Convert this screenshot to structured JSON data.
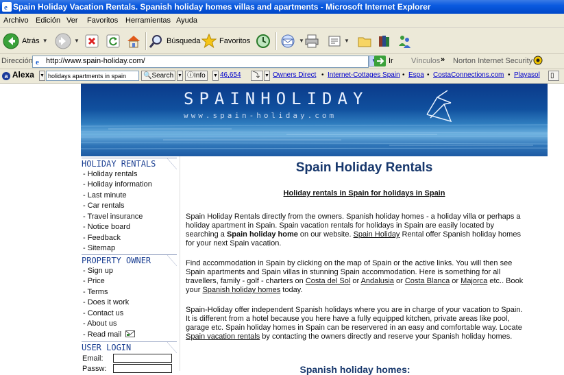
{
  "window": {
    "title": "Spain Holiday Vacation Rentals. Spanish holiday homes villas and apartments - Microsoft Internet Explorer"
  },
  "menu": [
    "Archivo",
    "Edición",
    "Ver",
    "Favoritos",
    "Herramientas",
    "Ayuda"
  ],
  "toolbar": {
    "back": "Atrás",
    "search": "Búsqueda",
    "favorites": "Favoritos"
  },
  "address": {
    "label": "Dirección",
    "url": "http://www.spain-holiday.com/",
    "go": "Ir",
    "links": "Vínculos",
    "chevron": "»",
    "norton": "Norton Internet Security"
  },
  "alexa": {
    "logo": "Alexa",
    "search_value": "holidays apartments in spain",
    "search_btn": "Search",
    "info_btn": "Info",
    "rank": "46,654",
    "links": [
      "Owners Direct",
      "Internet-Cottages Spain",
      "Espa",
      "CostaConnections.com",
      "Playasol"
    ],
    "bullet": "•"
  },
  "banner": {
    "title": "SPAINHOLIDAY",
    "url": "www.spain-holiday.com"
  },
  "sidebar": {
    "sections": [
      {
        "heading": "HOLIDAY RENTALS",
        "items": [
          "- Holiday rentals",
          "- Holiday information",
          "- Last minute",
          "- Car rentals",
          "- Travel insurance",
          "- Notice board",
          "- Feedback",
          "- Sitemap"
        ]
      },
      {
        "heading": "PROPERTY OWNER",
        "items": [
          "- Sign up",
          "- Price",
          "- Terms",
          "- Does it work",
          "- Contact us",
          "- About us",
          "- Read mail"
        ]
      },
      {
        "heading": "USER LOGIN"
      }
    ],
    "login": {
      "email_label": "Email:",
      "password_label": "Passw:"
    }
  },
  "main": {
    "heading": "Spain Holiday Rentals",
    "subheading": "Holiday rentals in Spain for holidays in Spain",
    "p1": {
      "t1": "Spain Holiday Rentals directly from the owners. Spanish holiday homes - a holiday villa or perhaps a holiday apartment in Spain. Spain vacation rentals for holidays in Spain are easily located by searching a ",
      "b1": "Spain holiday home",
      "t2": " on our website. ",
      "a1": "Spain Holiday",
      "t3": " Rental offer Spanish holiday homes for your next Spain vacation."
    },
    "p2": {
      "t1": "Find accommodation in Spain by clicking on the map of Spain or the active links. You will then see Spain apartments and Spain villas in stunning Spain accommodation. Here is something for all travellers, family - golf - charters on ",
      "a1": "Costa del Sol",
      "t2": " or ",
      "a2": "Andalusia",
      "t3": " or ",
      "a3": "Costa Blanca",
      "t4": " or ",
      "a4": "Majorca",
      "t5": " etc.. Book your ",
      "a5": "Spanish holiday homes",
      "t6": " today."
    },
    "p3": {
      "t1": "Spain-Holiday offer independent Spanish holidays where you are in charge of your vacation to Spain. It is different from a hotel because you here have a fully equipped kitchen, private areas like pool, garage etc. Spain holiday homes in Spain can be reservered in an easy and comfortable way. Locate ",
      "a1": "Spain vacation rentals",
      "t2": " by contacting the owners directly and reserve your Spanish holiday homes."
    },
    "section_heading": "Spanish holiday homes:"
  }
}
